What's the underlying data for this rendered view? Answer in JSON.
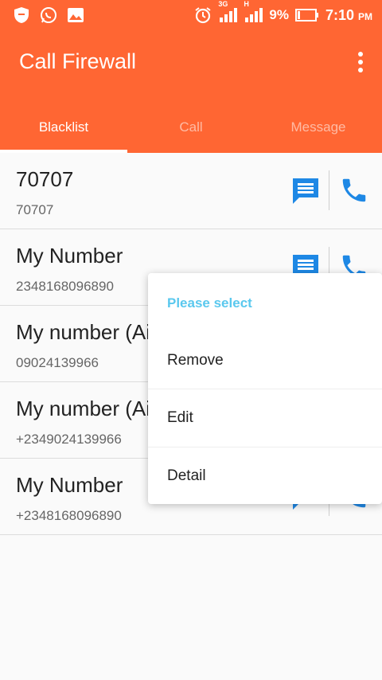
{
  "status_bar": {
    "icons_left": [
      "shield-icon",
      "whatsapp-icon",
      "image-icon"
    ],
    "alarm_icon": "alarm-icon",
    "signal1_label": "3G",
    "signal2_label": "H",
    "battery": "9%",
    "time": "7:10",
    "ampm": "PM"
  },
  "app_bar": {
    "title": "Call Firewall",
    "overflow_icon": "more-vert-icon"
  },
  "tabs": [
    {
      "label": "Blacklist",
      "active": true
    },
    {
      "label": "Call",
      "active": false
    },
    {
      "label": "Message",
      "active": false
    }
  ],
  "contacts": [
    {
      "name": "70707",
      "number": "70707"
    },
    {
      "name": "My Number",
      "number": "2348168096890"
    },
    {
      "name": "My number (Ai",
      "number": "09024139966"
    },
    {
      "name": "My number (Ai",
      "number": "+2349024139966"
    },
    {
      "name": "My Number",
      "number": "+2348168096890"
    }
  ],
  "context_menu": {
    "title": "Please select",
    "items": [
      "Remove",
      "Edit",
      "Detail"
    ]
  },
  "colors": {
    "primary": "#ff6633",
    "accent_blue": "#1e88e5",
    "menu_title": "#5ac8ee"
  }
}
